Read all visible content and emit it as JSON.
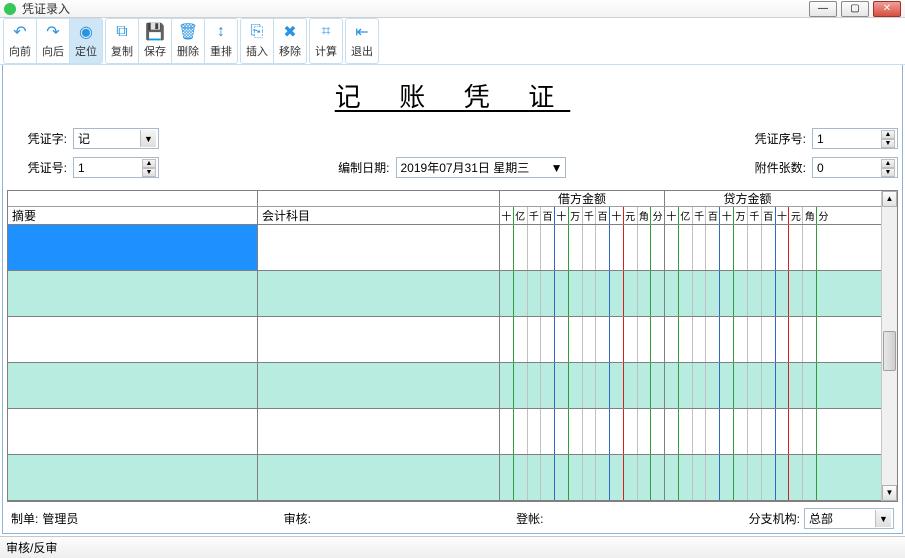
{
  "window": {
    "title": "凭证录入"
  },
  "toolbar": [
    {
      "label": "向前",
      "icon": "↶",
      "name": "prev"
    },
    {
      "label": "向后",
      "icon": "↷",
      "name": "next"
    },
    {
      "label": "定位",
      "icon": "◉",
      "name": "locate",
      "active": true
    },
    {
      "label": "复制",
      "icon": "⧉",
      "name": "copy"
    },
    {
      "label": "保存",
      "icon": "💾",
      "name": "save"
    },
    {
      "label": "删除",
      "icon": "🗑",
      "name": "delete"
    },
    {
      "label": "重排",
      "icon": "↕",
      "name": "reorder"
    },
    {
      "label": "插入",
      "icon": "⎘",
      "name": "insert"
    },
    {
      "label": "移除",
      "icon": "✖",
      "name": "remove"
    },
    {
      "label": "计算",
      "icon": "⌗",
      "name": "calc"
    },
    {
      "label": "退出",
      "icon": "⇤",
      "name": "exit"
    }
  ],
  "heading": "记 账 凭 证",
  "fields": {
    "voucher_word_label": "凭证字:",
    "voucher_word_value": "记",
    "voucher_seq_label": "凭证序号:",
    "voucher_seq_value": "1",
    "voucher_no_label": "凭证号:",
    "voucher_no_value": "1",
    "date_label": "编制日期:",
    "date_value": "2019年07月31日 星期三",
    "attach_label": "附件张数:",
    "attach_value": "0"
  },
  "table": {
    "headers": {
      "summary": "摘要",
      "account": "会计科目",
      "debit": "借方金额",
      "credit": "贷方金额"
    },
    "digits": [
      "十",
      "亿",
      "千",
      "百",
      "十",
      "万",
      "千",
      "百",
      "十",
      "元",
      "角",
      "分"
    ],
    "row_count": 6
  },
  "footer": {
    "maker_label": "制单:",
    "maker_value": "管理员",
    "auditor_label": "审核:",
    "poster_label": "登帐:",
    "branch_label": "分支机构:",
    "branch_value": "总部"
  },
  "status": "审核/反审"
}
